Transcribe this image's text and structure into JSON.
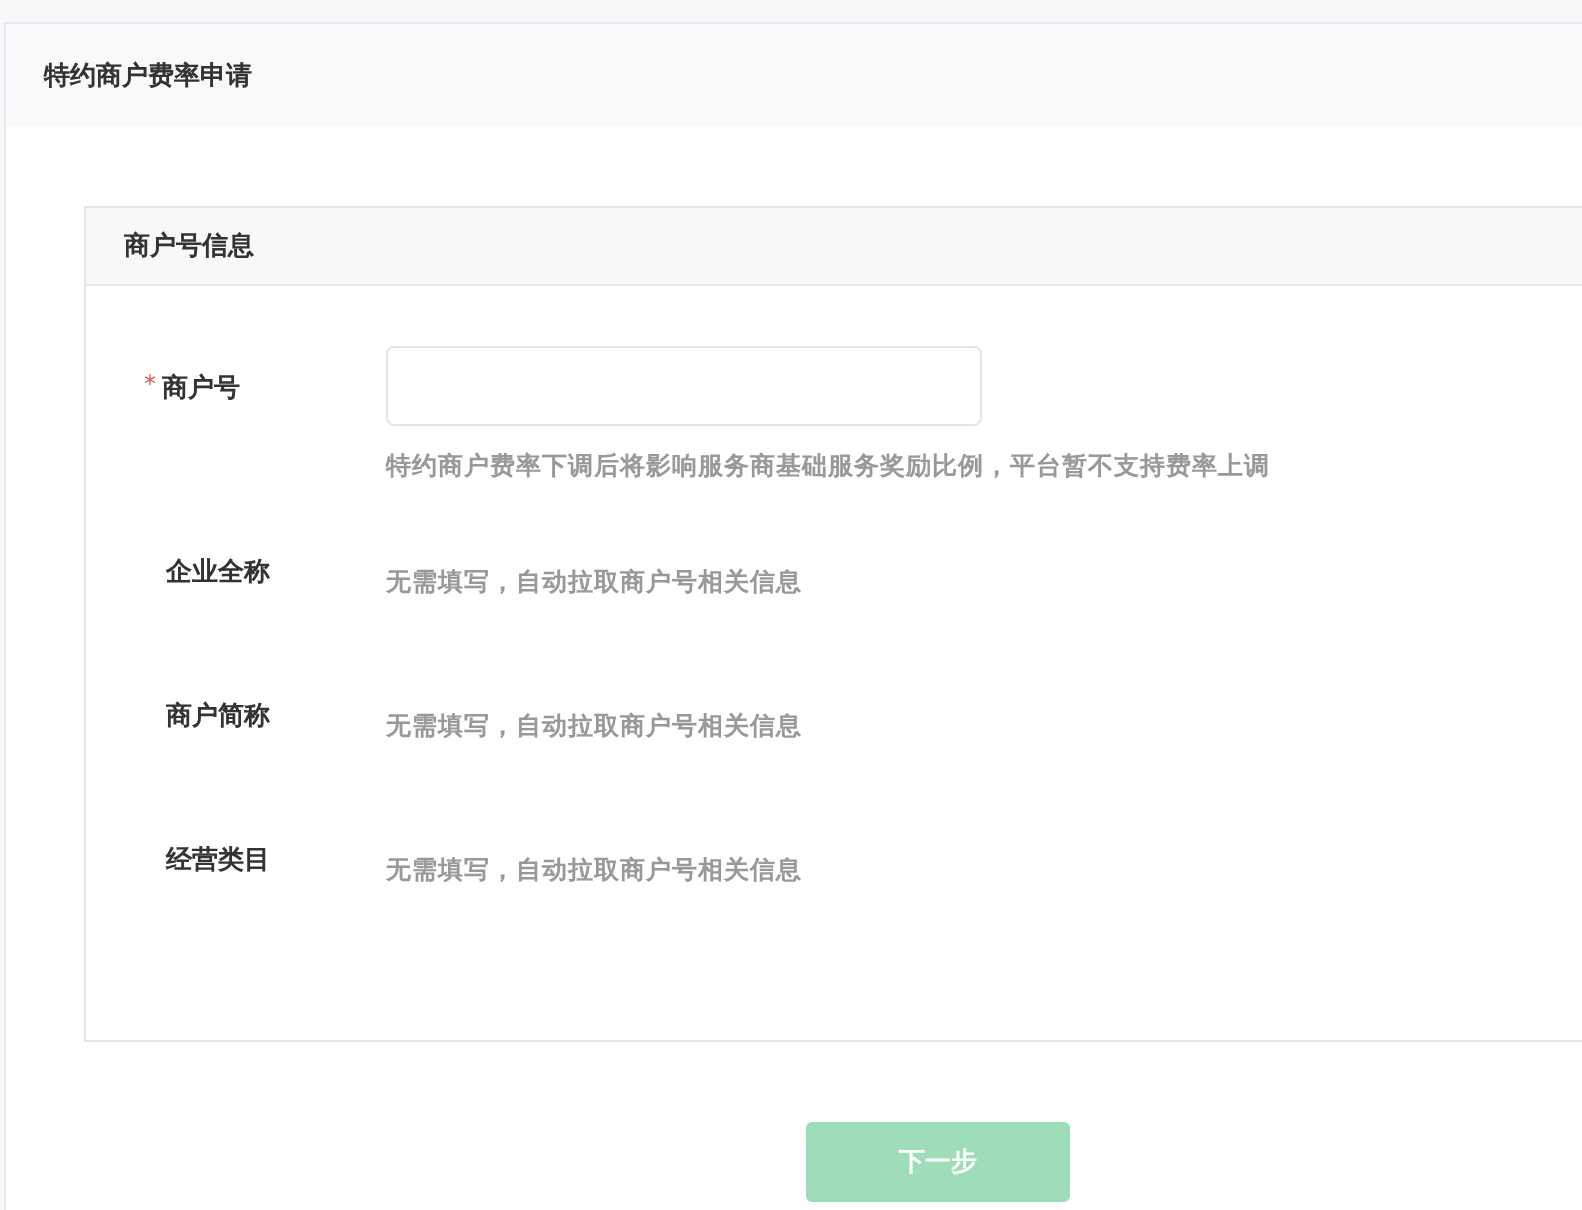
{
  "page_title": "特约商户费率申请",
  "section": {
    "title": "商户号信息",
    "fields": [
      {
        "kind": "input",
        "label": "商户号",
        "required_mark": "*",
        "hint": "特约商户费率下调后将影响服务商基础服务奖励比例，平台暂不支持费率上调"
      },
      {
        "kind": "info",
        "label": "企业全称",
        "hint": "无需填写，自动拉取商户号相关信息"
      },
      {
        "kind": "info",
        "label": "商户简称",
        "hint": "无需填写，自动拉取商户号相关信息"
      },
      {
        "kind": "info",
        "label": "经营类目",
        "hint": "无需填写，自动拉取商户号相关信息"
      }
    ]
  },
  "next_button": {
    "label": "下一步",
    "disabled": true
  }
}
